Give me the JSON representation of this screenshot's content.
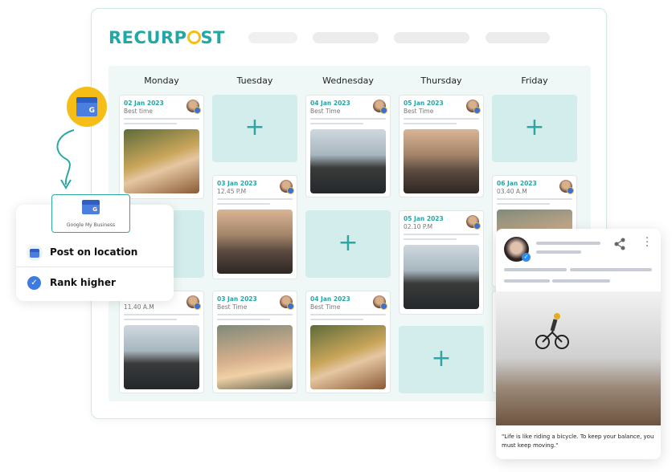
{
  "brand": {
    "logo_text_before": "RECURP",
    "logo_text_after": "ST",
    "accent": "#1fa9a6",
    "clock_color": "#f6bd16"
  },
  "calendar": {
    "days": [
      "Monday",
      "Tuesday",
      "Wednesday",
      "Thursday",
      "Friday"
    ],
    "add_icon": "plus-icon",
    "posts": [
      {
        "date": "02 Jan 2023",
        "time": "Best time"
      },
      {
        "date": "",
        "time": "11.40 A.M"
      },
      {
        "date": "03 Jan 2023",
        "time": "12.45 P.M"
      },
      {
        "date": "03 Jan 2023",
        "time": "Best Time"
      },
      {
        "date": "04 Jan 2023",
        "time": "Best Time"
      },
      {
        "date": "04 Jan 2023",
        "time": "Best Time"
      },
      {
        "date": "05 Jan 2023",
        "time": "Best Time"
      },
      {
        "date": "05 Jan 2023",
        "time": "02.10 P.M"
      },
      {
        "date": "06 Jan 2023",
        "time": "03.40 A.M"
      }
    ]
  },
  "gmb": {
    "logo_label": "Google My Business",
    "items": [
      {
        "label": "Post on location",
        "icon": "store-icon"
      },
      {
        "label": "Rank higher",
        "icon": "check-circle-icon"
      }
    ]
  },
  "post_preview": {
    "quote": "\"Life is like riding a bicycle. To keep your balance, you must keep moving.\"",
    "icons": [
      "share-icon",
      "more-vertical-icon",
      "verified-icon"
    ]
  }
}
